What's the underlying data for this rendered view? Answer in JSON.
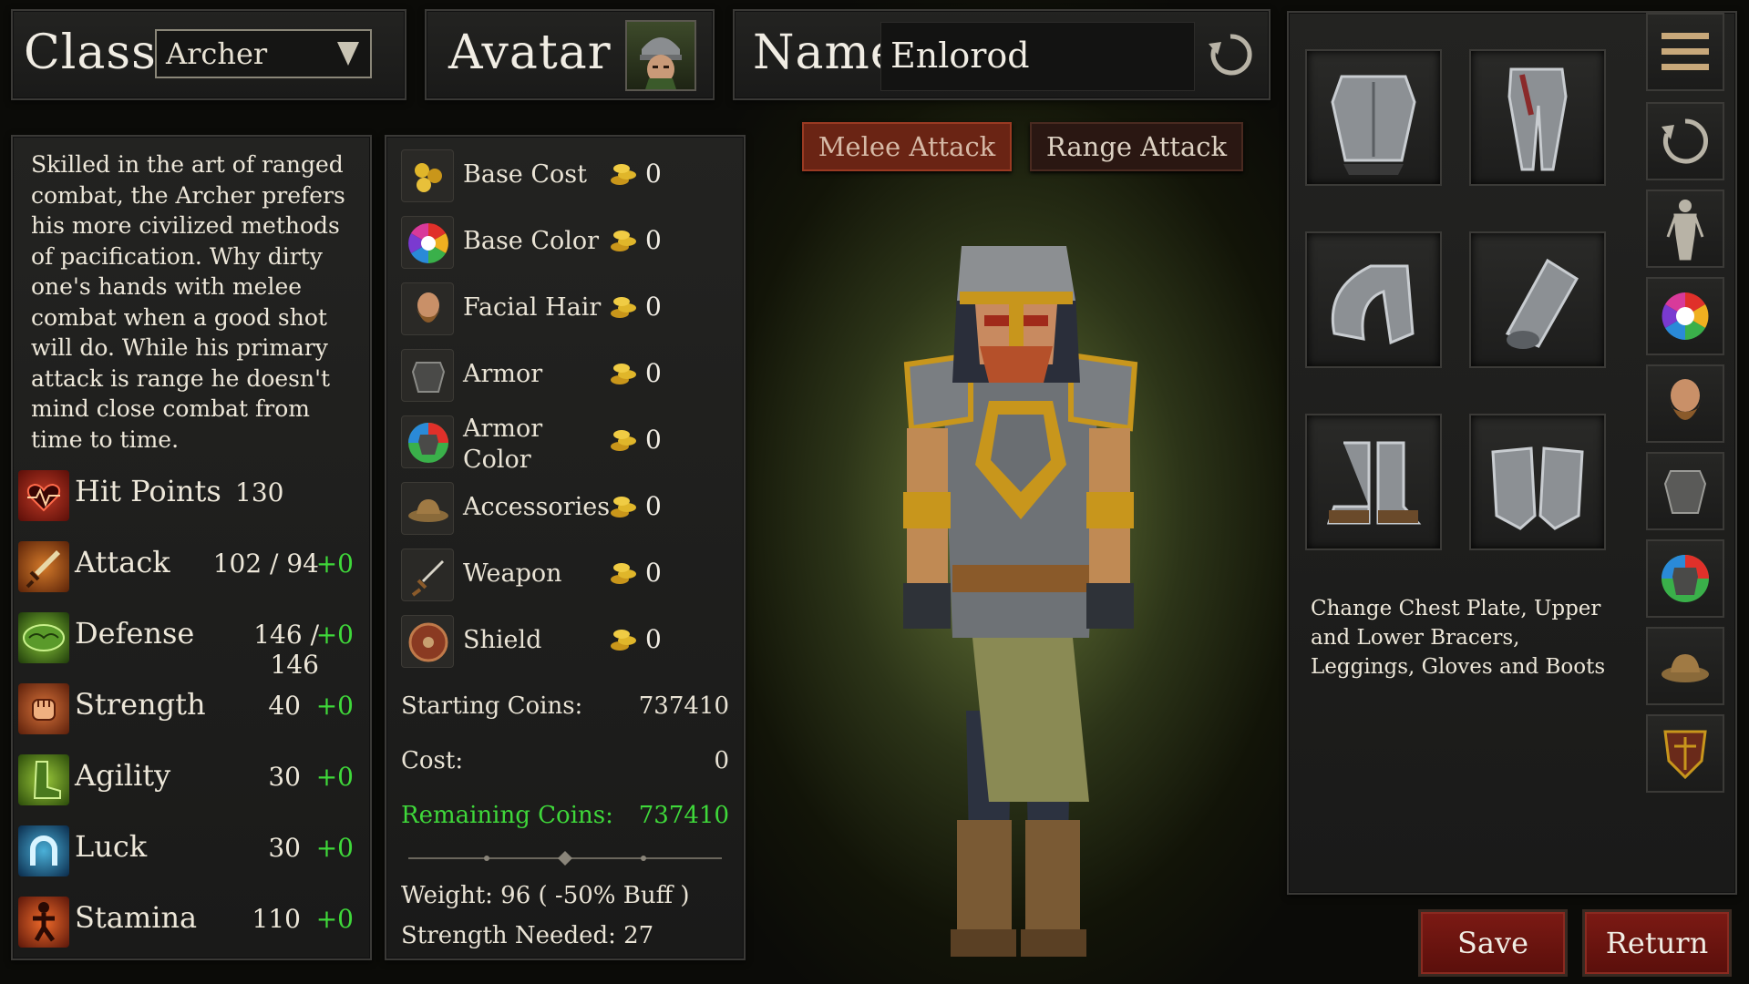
{
  "header": {
    "class_label": "Class",
    "class_value": "Archer",
    "avatar_label": "Avatar",
    "name_label": "Name",
    "name_value": "Enlorod"
  },
  "description": "Skilled in the art of ranged combat, the Archer prefers his more civilized methods of pacification. Why dirty one's hands with melee combat when a good shot will do. While his primary attack is range he doesn't mind close combat from time to time.",
  "stats": [
    {
      "label": "Hit Points",
      "value": "130",
      "bonus": "",
      "icon": "heart-pulse-icon",
      "color": "#a3221a"
    },
    {
      "label": "Attack",
      "value": "102 / 94",
      "bonus": "+0",
      "icon": "sword-icon",
      "color": "#b0501a"
    },
    {
      "label": "Defense",
      "value": "146 / 146",
      "bonus": "+0",
      "icon": "scale-armor-icon",
      "color": "#3f7a24"
    },
    {
      "label": "Strength",
      "value": "40",
      "bonus": "+0",
      "icon": "fist-icon",
      "color": "#b04a1e"
    },
    {
      "label": "Agility",
      "value": "30",
      "bonus": "+0",
      "icon": "boot-icon",
      "color": "#4e7a1e"
    },
    {
      "label": "Luck",
      "value": "30",
      "bonus": "+0",
      "icon": "horseshoe-icon",
      "color": "#1f5a7a"
    },
    {
      "label": "Stamina",
      "value": "110",
      "bonus": "+0",
      "icon": "runner-icon",
      "color": "#b03c1a"
    }
  ],
  "costs": [
    {
      "label": "Base Cost",
      "amount": "0",
      "icon": "coins-icon"
    },
    {
      "label": "Base Color",
      "amount": "0",
      "icon": "color-wheel-icon"
    },
    {
      "label": "Facial Hair",
      "amount": "0",
      "icon": "beard-icon"
    },
    {
      "label": "Armor",
      "amount": "0",
      "icon": "armor-icon"
    },
    {
      "label_line1": "Armor",
      "label_line2": "Color",
      "amount": "0",
      "icon": "armor-color-icon"
    },
    {
      "label": "Accessories",
      "amount": "0",
      "icon": "hat-icon"
    },
    {
      "label": "Weapon",
      "amount": "0",
      "icon": "dagger-icon"
    },
    {
      "label": "Shield",
      "amount": "0",
      "icon": "round-shield-icon"
    }
  ],
  "summary": {
    "starting_label": "Starting Coins:",
    "starting_value": "737410",
    "cost_label": "Cost:",
    "cost_value": "0",
    "remaining_label": "Remaining Coins:",
    "remaining_value": "737410",
    "weight_text": "Weight: 96 ( -50% Buff )",
    "strength_text": "Strength Needed: 27"
  },
  "attack_tabs": {
    "melee": "Melee Attack",
    "range": "Range Attack"
  },
  "equipment": {
    "slots": [
      "chest-plate-icon",
      "leggings-icon",
      "upper-bracer-icon",
      "lower-bracer-icon",
      "boots-icon",
      "gloves-icon"
    ],
    "description": "Change Chest Plate, Upper and Lower Bracers, Leggings, Gloves and Boots"
  },
  "side_menu": [
    "menu-icon",
    "reset-rotation-icon",
    "body-icon",
    "color-wheel-icon",
    "beard-icon",
    "armor-icon",
    "armor-color-icon",
    "hat-icon",
    "shield-icon"
  ],
  "buttons": {
    "save": "Save",
    "return": "Return"
  },
  "colors": {
    "bonus_green": "#3fd83a",
    "remaining_green": "#3fd83a",
    "button_red": "#6e1510",
    "gold": "#d4a21c"
  }
}
